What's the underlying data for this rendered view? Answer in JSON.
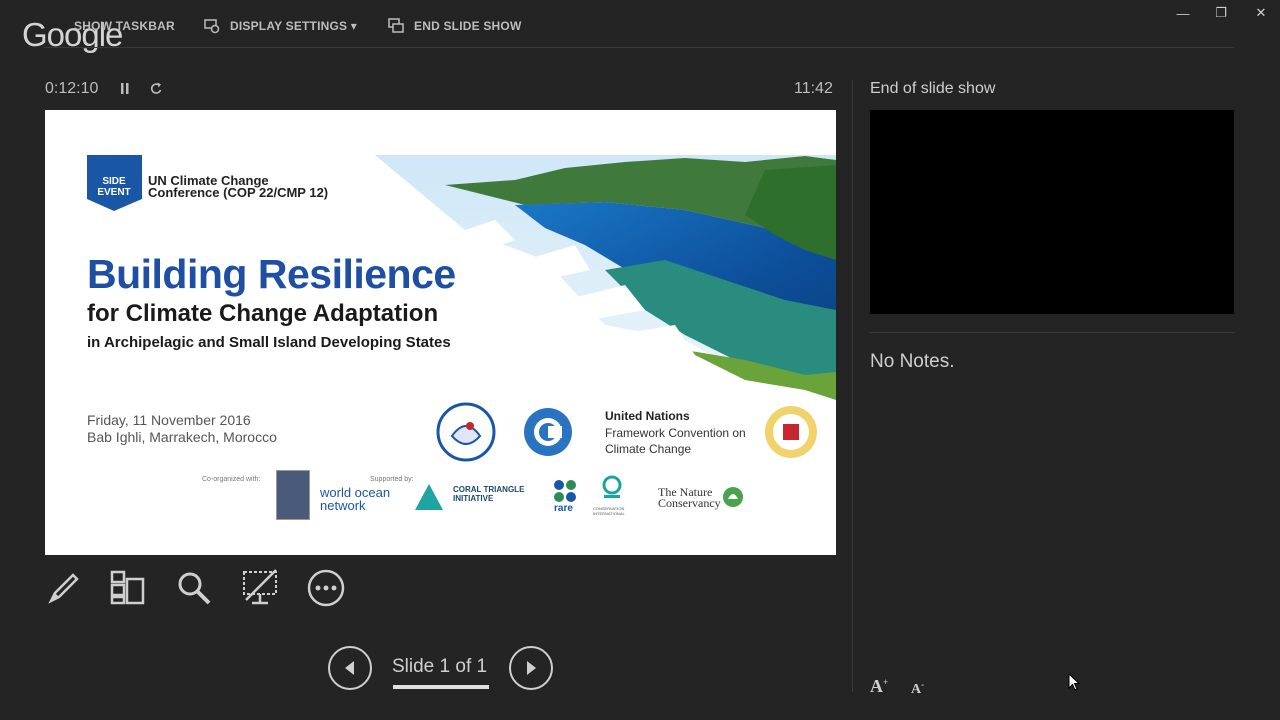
{
  "overlay": {
    "logo": "Google"
  },
  "toolbar": {
    "show_taskbar": "SHOW TASKBAR",
    "display_settings": "DISPLAY SETTINGS ▾",
    "end_slide_show": "END SLIDE SHOW"
  },
  "window": {
    "minimize": "—",
    "restore": "❐",
    "close": "✕"
  },
  "presenter": {
    "elapsed_time": "0:12:10",
    "clock": "11:42",
    "next_slide_title": "End of slide show",
    "notes": "No Notes.",
    "slide_counter": "Slide 1 of 1"
  },
  "slide": {
    "badge": "SIDE EVENT",
    "conference_line1": "UN Climate Change",
    "conference_line2": "Conference (COP 22/CMP 12)",
    "title": "Building Resilience",
    "subtitle": "for Climate Change Adaptation",
    "tagline": "in Archipelagic and Small Island Developing States",
    "date": "Friday, 11 November 2016",
    "venue": "Bab Ighli, Marrakech, Morocco",
    "unfccc_line1": "United Nations",
    "unfccc_line2": "Framework Convention on",
    "unfccc_line3": "Climate Change",
    "co_organized": "Co-organized with:",
    "supported_by": "Supported by:",
    "sponsors": [
      "world ocean network",
      "CORAL TRIANGLE INITIATIVE",
      "rare",
      "CONSERVATION INTERNATIONAL",
      "The Nature Conservancy"
    ]
  },
  "colors": {
    "title_blue": "#1e4fa3",
    "badge_blue": "#1a56a6",
    "background": "#242424"
  },
  "icons": [
    "pen-icon",
    "see-all-slides-icon",
    "zoom-icon",
    "black-screen-icon",
    "more-options-icon",
    "prev-arrow-icon",
    "next-arrow-icon",
    "pause-icon",
    "reset-icon"
  ]
}
